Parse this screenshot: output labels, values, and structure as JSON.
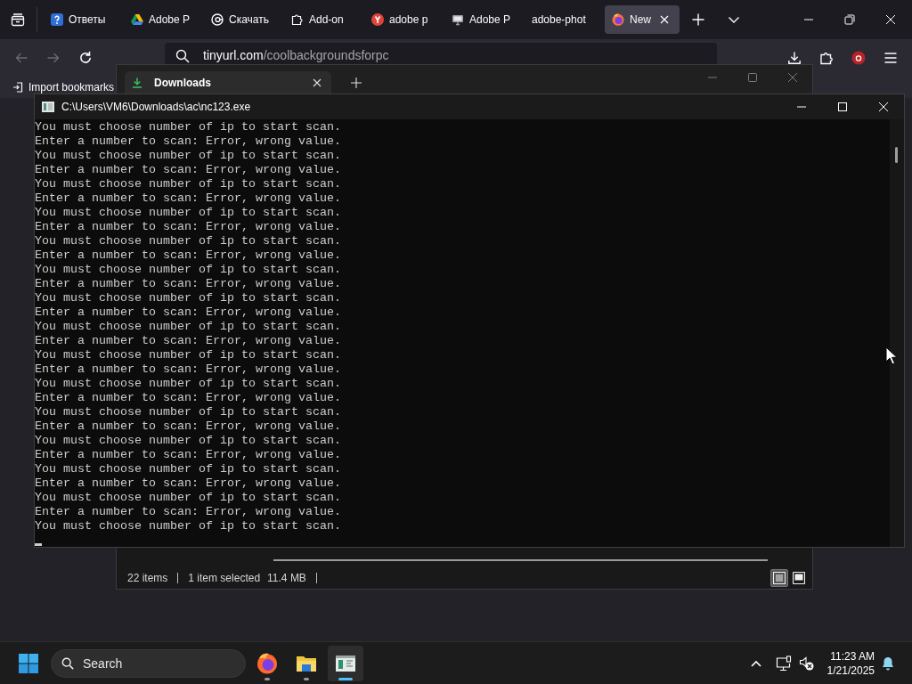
{
  "browser": {
    "tabs": [
      {
        "label": "Ответы",
        "selected": false
      },
      {
        "label": "Adobe P",
        "selected": false
      },
      {
        "label": "Скачать",
        "selected": false
      },
      {
        "label": "Add-on",
        "selected": false
      },
      {
        "label": "adobe p",
        "selected": false
      },
      {
        "label": "Adobe P",
        "selected": false
      },
      {
        "label": "adobe-phot",
        "selected": false
      },
      {
        "label": "New",
        "selected": true
      }
    ],
    "back": {
      "disabled": true
    },
    "forward": {
      "disabled": true
    },
    "address": {
      "host": "tinyurl.com",
      "path": "/coolbackgroundsforpc"
    },
    "bookmarks": [
      {
        "label": "Import bookmarks"
      }
    ]
  },
  "downloads_window": {
    "focused": false,
    "tab": "Downloads",
    "status": {
      "count": "22 items",
      "selection": "1 item selected",
      "size": "11.4 MB"
    },
    "views": [
      {
        "selected": true
      },
      {
        "selected": false
      }
    ]
  },
  "console_window": {
    "title": "C:\\Users\\VM6\\Downloads\\ac\\nc123.exe",
    "lines": [
      "You must choose number of ip to start scan.",
      "Enter a number to scan: Error, wrong value.",
      "You must choose number of ip to start scan.",
      "Enter a number to scan: Error, wrong value.",
      "You must choose number of ip to start scan.",
      "Enter a number to scan: Error, wrong value.",
      "You must choose number of ip to start scan.",
      "Enter a number to scan: Error, wrong value.",
      "You must choose number of ip to start scan.",
      "Enter a number to scan: Error, wrong value.",
      "You must choose number of ip to start scan.",
      "Enter a number to scan: Error, wrong value.",
      "You must choose number of ip to start scan.",
      "Enter a number to scan: Error, wrong value.",
      "You must choose number of ip to start scan.",
      "Enter a number to scan: Error, wrong value.",
      "You must choose number of ip to start scan.",
      "Enter a number to scan: Error, wrong value.",
      "You must choose number of ip to start scan.",
      "Enter a number to scan: Error, wrong value.",
      "You must choose number of ip to start scan.",
      "Enter a number to scan: Error, wrong value.",
      "You must choose number of ip to start scan.",
      "Enter a number to scan: Error, wrong value.",
      "You must choose number of ip to start scan.",
      "Enter a number to scan: Error, wrong value.",
      "You must choose number of ip to start scan.",
      "Enter a number to scan: Error, wrong value.",
      "You must choose number of ip to start scan."
    ]
  },
  "taskbar": {
    "search": {
      "placeholder": "Search"
    },
    "apps": [
      {
        "running": true,
        "selected": false
      },
      {
        "running": true,
        "selected": false
      },
      {
        "running": true,
        "selected": true
      }
    ],
    "clock": {
      "time": "11:23 AM",
      "date": "1/21/2025"
    }
  }
}
